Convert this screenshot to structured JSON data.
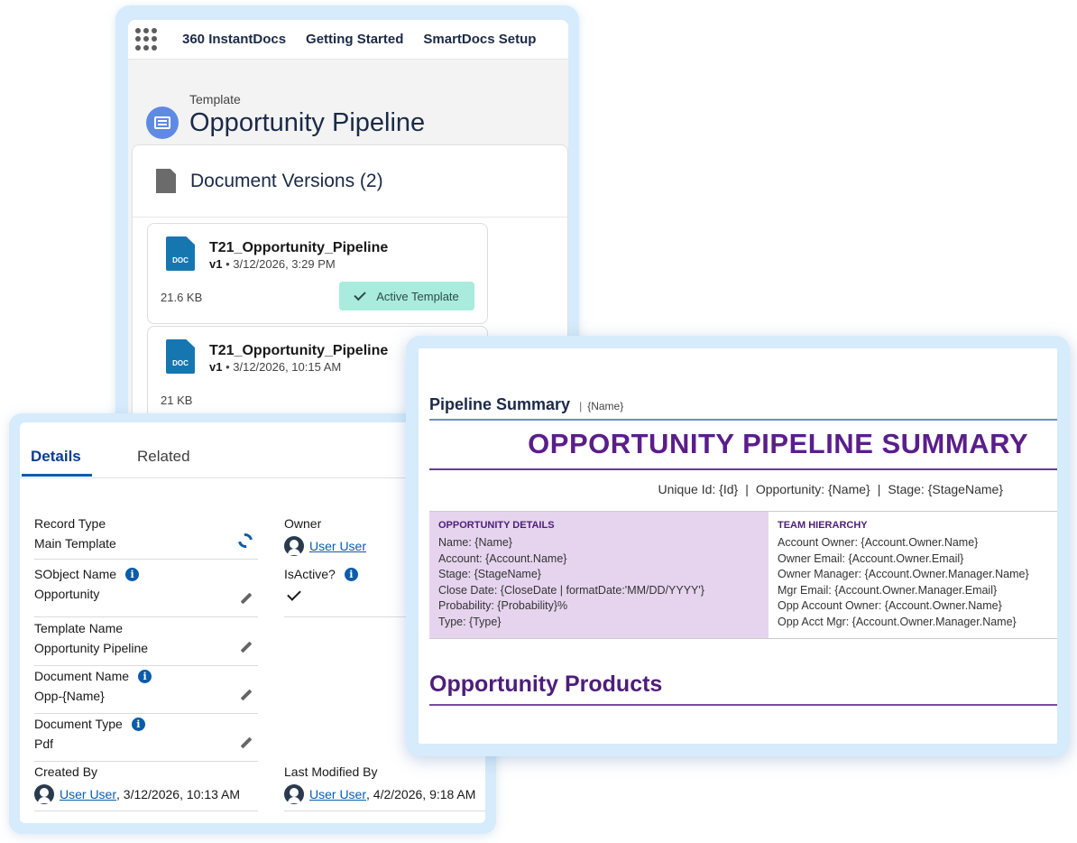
{
  "nav": {
    "items": [
      "360 InstantDocs",
      "Getting Started",
      "SmartDocs Setup"
    ]
  },
  "template": {
    "label": "Template",
    "title": "Opportunity Pipeline"
  },
  "versions": {
    "title": "Document Versions (2)",
    "items": [
      {
        "icon_text": "DOC",
        "name": "T21_Opportunity_Pipeline",
        "version": "v1",
        "timestamp": " • 3/12/2026, 3:29 PM",
        "size": "21.6 KB",
        "badge": "Active Template"
      },
      {
        "icon_text": "DOC",
        "name": "T21_Opportunity_Pipeline",
        "version": "v1",
        "timestamp": " • 3/12/2026, 10:15 AM",
        "size": "21 KB"
      }
    ]
  },
  "details": {
    "tabs": [
      "Details",
      "Related"
    ],
    "record_type": {
      "label": "Record Type",
      "value": "Main Template"
    },
    "owner": {
      "label": "Owner",
      "value": "User User"
    },
    "sobject_name": {
      "label": "SObject Name",
      "value": "Opportunity"
    },
    "is_active": {
      "label": "IsActive?"
    },
    "template_name": {
      "label": "Template Name",
      "value": "Opportunity Pipeline"
    },
    "document_name": {
      "label": "Document Name",
      "value": "Opp-{Name}"
    },
    "document_type": {
      "label": "Document Type",
      "value": "Pdf"
    },
    "created_by": {
      "label": "Created By",
      "user": "User User",
      "date": ", 3/12/2026, 10:13 AM"
    },
    "last_modified_by": {
      "label": "Last Modified By",
      "user": "User User",
      "date": ", 4/2/2026, 9:18 AM"
    }
  },
  "preview": {
    "section_title": "Pipeline Summary",
    "section_sub": "{Name}",
    "big_title": "OPPORTUNITY PIPELINE SUMMARY",
    "ids": {
      "unique": "Unique Id: {Id}",
      "opportunity": "Opportunity: {Name}",
      "stage": "Stage: {StageName}"
    },
    "opportunity_details": {
      "heading": "OPPORTUNITY DETAILS",
      "lines": [
        "Name: {Name}",
        "Account: {Account.Name}",
        "Stage: {StageName}",
        "Close Date: {CloseDate | formatDate:'MM/DD/YYYY'}",
        "Probability: {Probability}%",
        "Type: {Type}"
      ]
    },
    "team_hierarchy": {
      "heading": "TEAM HIERARCHY",
      "lines": [
        "Account Owner: {Account.Owner.Name}",
        "Owner Email: {Account.Owner.Email}",
        "Owner Manager: {Account.Owner.Manager.Name}",
        "Mgr Email: {Account.Owner.Manager.Email}",
        "Opp Account Owner: {Account.Owner.Name}",
        "Opp Acct Mgr: {Account.Owner.Manager.Name}"
      ]
    },
    "products_title": "Opportunity Products"
  },
  "colors": {
    "panel_bg": "#d6ebfb",
    "navy": "#1b2a48",
    "brand_blue": "#0b5cab",
    "purple": "#5a1e8a",
    "active_badge": "#a9ecdd",
    "lavender": "#e6d4ef"
  },
  "icons": [
    "app-launcher-icon",
    "template-icon",
    "document-icon",
    "doc-file-icon",
    "check-icon",
    "info-icon",
    "edit-icon",
    "sync-icon",
    "user-avatar-icon"
  ]
}
